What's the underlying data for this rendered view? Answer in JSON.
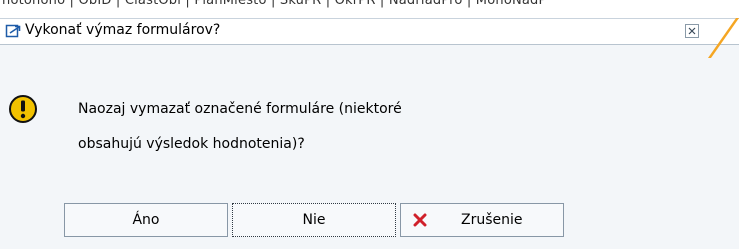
{
  "background": {
    "header_text": "notonóho         | ObID  | CiastObl | PlánMiesto | SkuPR | OkrPR | NadriadPro | MonoNadP"
  },
  "dialog": {
    "title": "Vykonať výmaz formulárov?",
    "message_line1": "Naozaj vymazať označené formuláre (niektoré",
    "message_line2": "obsahujú výsledok hodnotenia)?",
    "icons": {
      "title": "window-icon",
      "warning": "exclamation-icon",
      "close": "close-icon",
      "cancel": "red-x-icon"
    },
    "colors": {
      "accent": "#f5a623",
      "warning": "#f2c200",
      "cancel_x": "#d0202a"
    },
    "buttons": {
      "yes_label": "Áno",
      "no_label": "Nie",
      "cancel_label": "Zrušenie"
    }
  }
}
